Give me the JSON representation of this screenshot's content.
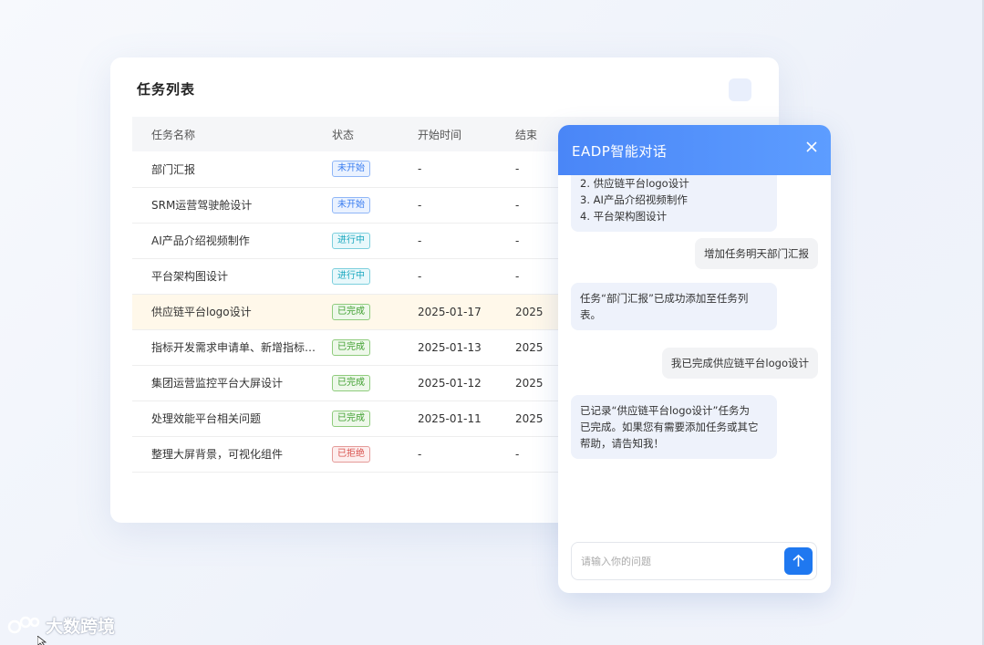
{
  "task_list": {
    "title": "任务列表",
    "columns": [
      "任务名称",
      "状态",
      "开始时间",
      "结束"
    ],
    "rows": [
      {
        "name": "部门汇报",
        "status": "未开始",
        "status_type": "not-started",
        "start": "-",
        "end": "-"
      },
      {
        "name": "SRM运营驾驶舱设计",
        "status": "未开始",
        "status_type": "not-started",
        "start": "-",
        "end": "-"
      },
      {
        "name": "AI产品介绍视频制作",
        "status": "进行中",
        "status_type": "in-progress",
        "start": "-",
        "end": "-"
      },
      {
        "name": "平台架构图设计",
        "status": "进行中",
        "status_type": "in-progress",
        "start": "-",
        "end": "-"
      },
      {
        "name": "供应链平台logo设计",
        "status": "已完成",
        "status_type": "done",
        "start": "2025-01-17",
        "end": "2025",
        "highlight": true
      },
      {
        "name": "指标开发需求申请单、新增指标需…",
        "status": "已完成",
        "status_type": "done",
        "start": "2025-01-13",
        "end": "2025"
      },
      {
        "name": "集团运营监控平台大屏设计",
        "status": "已完成",
        "status_type": "done",
        "start": "2025-01-12",
        "end": "2025"
      },
      {
        "name": "处理效能平台相关问题",
        "status": "已完成",
        "status_type": "done",
        "start": "2025-01-11",
        "end": "2025"
      },
      {
        "name": "整理大屏背景，可视化组件",
        "status": "已拒绝",
        "status_type": "rejected",
        "start": "-",
        "end": "-"
      }
    ]
  },
  "chat": {
    "title": "EADP智能对话",
    "messages": [
      {
        "role": "bot",
        "lines": [
          "2. 供应链平台logo设计",
          "3. AI产品介绍视频制作",
          "4. 平台架构图设计"
        ]
      },
      {
        "role": "user",
        "lines": [
          "增加任务明天部门汇报"
        ]
      },
      {
        "role": "bot",
        "lines": [
          "任务“部门汇报”已成功添加至任务列",
          "表。"
        ]
      },
      {
        "role": "user",
        "lines": [
          "我已完成供应链平台logo设计"
        ]
      },
      {
        "role": "bot",
        "lines": [
          "已记录“供应链平台logo设计”任务为",
          "已完成。如果您有需要添加任务或其它",
          "帮助，请告知我！"
        ]
      }
    ],
    "input_placeholder": "请输入你的问题"
  },
  "watermark": {
    "text": "大数跨境"
  },
  "colors": {
    "accent": "#4a86f7",
    "send": "#1f78f0",
    "highlight_row": "#fff8ea"
  }
}
